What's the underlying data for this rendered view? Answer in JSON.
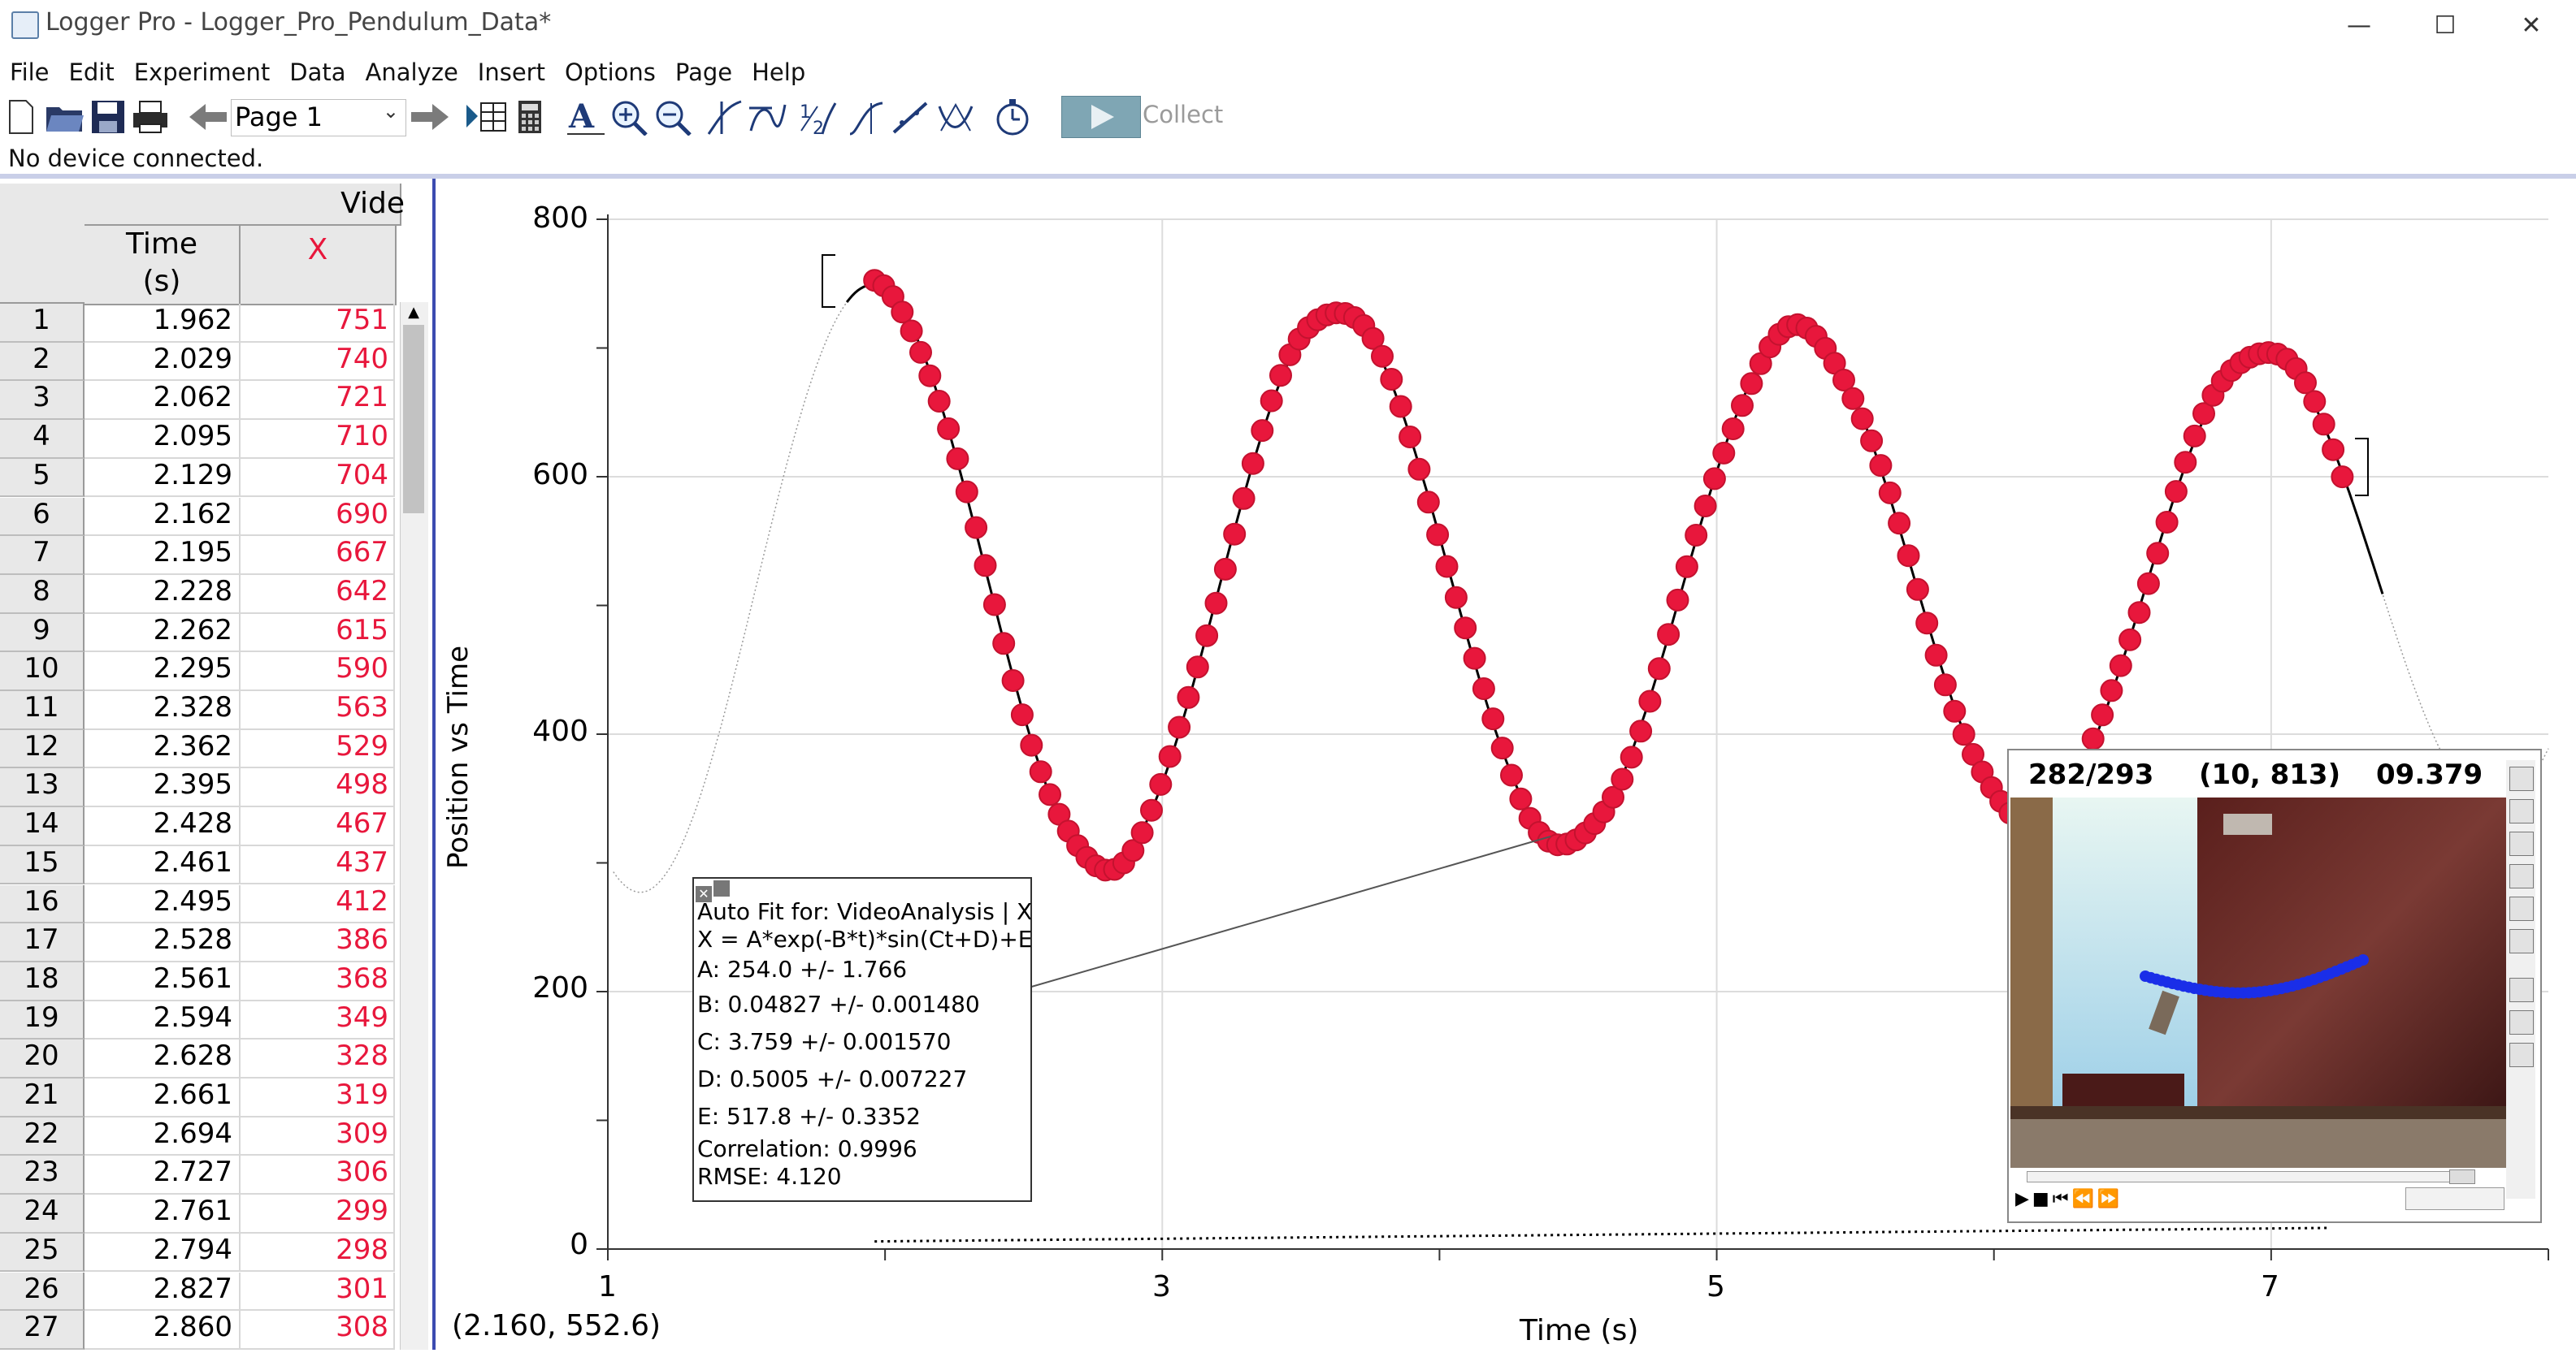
{
  "window": {
    "title": "Logger Pro - Logger_Pro_Pendulum_Data*",
    "controls": {
      "minimize": "—",
      "maximize": "☐",
      "close": "✕"
    }
  },
  "menu": [
    "File",
    "Edit",
    "Experiment",
    "Data",
    "Analyze",
    "Insert",
    "Options",
    "Page",
    "Help"
  ],
  "toolbar": {
    "page_select": "Page 1",
    "collect_label": "Collect",
    "icons": [
      "new-file-icon",
      "open-folder-icon",
      "save-icon",
      "print-icon",
      "back-arrow-icon",
      "forward-arrow-icon",
      "data-browser-icon",
      "calculator-icon",
      "autoscale-icon",
      "zoom-in-icon",
      "zoom-out-icon",
      "examine-icon",
      "tangent-icon",
      "integral-icon",
      "statistics-icon",
      "linear-fit-icon",
      "curve-fit-icon",
      "stopwatch-icon",
      "play-icon"
    ]
  },
  "status": "No device connected.",
  "table": {
    "group_header": "Vide",
    "columns": [
      "Time\n(s)",
      "X"
    ],
    "rows": [
      [
        "1",
        "1.962",
        "751"
      ],
      [
        "2",
        "2.029",
        "740"
      ],
      [
        "3",
        "2.062",
        "721"
      ],
      [
        "4",
        "2.095",
        "710"
      ],
      [
        "5",
        "2.129",
        "704"
      ],
      [
        "6",
        "2.162",
        "690"
      ],
      [
        "7",
        "2.195",
        "667"
      ],
      [
        "8",
        "2.228",
        "642"
      ],
      [
        "9",
        "2.262",
        "615"
      ],
      [
        "10",
        "2.295",
        "590"
      ],
      [
        "11",
        "2.328",
        "563"
      ],
      [
        "12",
        "2.362",
        "529"
      ],
      [
        "13",
        "2.395",
        "498"
      ],
      [
        "14",
        "2.428",
        "467"
      ],
      [
        "15",
        "2.461",
        "437"
      ],
      [
        "16",
        "2.495",
        "412"
      ],
      [
        "17",
        "2.528",
        "386"
      ],
      [
        "18",
        "2.561",
        "368"
      ],
      [
        "19",
        "2.594",
        "349"
      ],
      [
        "20",
        "2.628",
        "328"
      ],
      [
        "21",
        "2.661",
        "319"
      ],
      [
        "22",
        "2.694",
        "309"
      ],
      [
        "23",
        "2.727",
        "306"
      ],
      [
        "24",
        "2.761",
        "299"
      ],
      [
        "25",
        "2.794",
        "298"
      ],
      [
        "26",
        "2.827",
        "301"
      ],
      [
        "27",
        "2.860",
        "308"
      ]
    ]
  },
  "graph": {
    "ylabel": "Position vs Time",
    "xlabel": "Time (s)",
    "coords": "(2.160, 552.6)",
    "yticks": [
      "800",
      "600",
      "400",
      "200",
      "0"
    ],
    "xticks": [
      "1",
      "3",
      "5",
      "7"
    ]
  },
  "chart_data": {
    "type": "scatter",
    "xlabel": "Time (s)",
    "ylabel": "Position vs Time",
    "xlim": [
      1,
      8
    ],
    "ylim": [
      0,
      800
    ],
    "series": [
      {
        "name": "X",
        "x_start": 1.962,
        "x_end": 7.26,
        "x_step": 0.0333
      }
    ],
    "fit": {
      "A": 254.0,
      "B": 0.04827,
      "C": 3.759,
      "D": 0.5005,
      "E": 517.8
    }
  },
  "fit_box": {
    "title": "Auto Fit for: VideoAnalysis | X",
    "equation": "X = A*exp(-B*t)*sin(Ct+D)+E",
    "params": [
      "A: 254.0 +/- 1.766",
      "B: 0.04827 +/- 0.001480",
      "C: 3.759 +/- 0.001570",
      "D: 0.5005 +/- 0.007227",
      "E: 517.8 +/- 0.3352"
    ],
    "correlation": "Correlation: 0.9996",
    "rmse": "RMSE: 4.120"
  },
  "video": {
    "frame": "282/293",
    "coord": "(10, 813)",
    "time": "09.379"
  },
  "colors": {
    "accent_red": "#e8173c",
    "title_bar_blue": "#3c4bb0",
    "track_blue": "#1a2ee8"
  }
}
